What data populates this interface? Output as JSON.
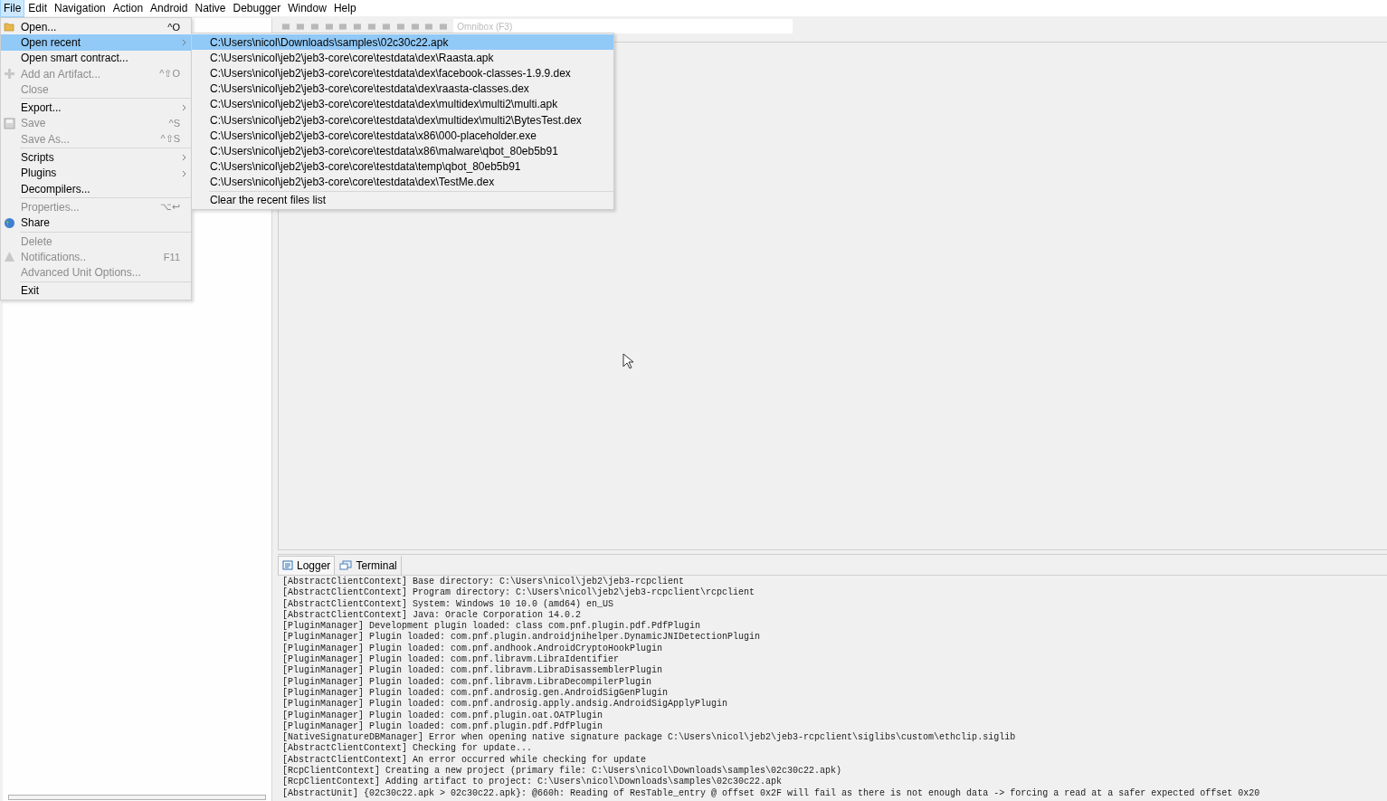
{
  "menubar": [
    {
      "label": "File",
      "selected": true
    },
    {
      "label": "Edit",
      "selected": false
    },
    {
      "label": "Navigation",
      "selected": false
    },
    {
      "label": "Action",
      "selected": false
    },
    {
      "label": "Android",
      "selected": false
    },
    {
      "label": "Native",
      "selected": false
    },
    {
      "label": "Debugger",
      "selected": false
    },
    {
      "label": "Window",
      "selected": false
    },
    {
      "label": "Help",
      "selected": false
    }
  ],
  "omnibox": {
    "placeholder": "Omnibox (F3)"
  },
  "file_menu": [
    {
      "kind": "folder",
      "label": "Open...",
      "shortcut": "^O",
      "disabled": false,
      "submenu": false,
      "selected": false
    },
    {
      "kind": "plain",
      "label": "Open recent",
      "disabled": false,
      "submenu": true,
      "selected": true
    },
    {
      "kind": "plain",
      "label": "Open smart contract...",
      "disabled": false,
      "submenu": false,
      "selected": false
    },
    {
      "kind": "plus",
      "label": "Add an Artifact...",
      "shortcut": "^⇧O",
      "disabled": true,
      "submenu": false,
      "selected": false
    },
    {
      "kind": "plain",
      "label": "Close",
      "disabled": true,
      "submenu": false,
      "selected": false
    },
    {
      "kind": "separator"
    },
    {
      "kind": "plain",
      "label": "Export...",
      "disabled": false,
      "submenu": true,
      "selected": false
    },
    {
      "kind": "disk",
      "label": "Save",
      "shortcut": "^S",
      "disabled": true,
      "submenu": false,
      "selected": false
    },
    {
      "kind": "plain",
      "label": "Save As...",
      "shortcut": "^⇧S",
      "disabled": true,
      "submenu": false,
      "selected": false
    },
    {
      "kind": "separator"
    },
    {
      "kind": "plain",
      "label": "Scripts",
      "disabled": false,
      "submenu": true,
      "selected": false
    },
    {
      "kind": "plain",
      "label": "Plugins",
      "disabled": false,
      "submenu": true,
      "selected": false
    },
    {
      "kind": "plain",
      "label": "Decompilers...",
      "disabled": false,
      "submenu": false,
      "selected": false
    },
    {
      "kind": "separator"
    },
    {
      "kind": "plain",
      "label": "Properties...",
      "shortcut": "⌥↩",
      "disabled": true,
      "submenu": false,
      "selected": false
    },
    {
      "kind": "globe",
      "label": "Share",
      "disabled": false,
      "submenu": false,
      "selected": false
    },
    {
      "kind": "separator"
    },
    {
      "kind": "plain",
      "label": "Delete",
      "disabled": true,
      "submenu": false,
      "selected": false
    },
    {
      "kind": "warning",
      "label": "Notifications..",
      "shortcut": "F11",
      "disabled": true,
      "submenu": false,
      "selected": false
    },
    {
      "kind": "plain",
      "label": "Advanced Unit Options...",
      "disabled": true,
      "submenu": false,
      "selected": false
    },
    {
      "kind": "separator"
    },
    {
      "kind": "plain",
      "label": "Exit",
      "disabled": false,
      "submenu": false,
      "selected": false
    }
  ],
  "recent_menu": [
    {
      "kind": "item",
      "label": "C:\\Users\\nicol\\Downloads\\samples\\02c30c22.apk",
      "selected": true
    },
    {
      "kind": "item",
      "label": "C:\\Users\\nicol\\jeb2\\jeb3-core\\core\\testdata\\dex\\Raasta.apk",
      "selected": false
    },
    {
      "kind": "item",
      "label": "C:\\Users\\nicol\\jeb2\\jeb3-core\\core\\testdata\\dex\\facebook-classes-1.9.9.dex",
      "selected": false
    },
    {
      "kind": "item",
      "label": "C:\\Users\\nicol\\jeb2\\jeb3-core\\core\\testdata\\dex\\raasta-classes.dex",
      "selected": false
    },
    {
      "kind": "item",
      "label": "C:\\Users\\nicol\\jeb2\\jeb3-core\\core\\testdata\\dex\\multidex\\multi2\\multi.apk",
      "selected": false
    },
    {
      "kind": "item",
      "label": "C:\\Users\\nicol\\jeb2\\jeb3-core\\core\\testdata\\dex\\multidex\\multi2\\BytesTest.dex",
      "selected": false
    },
    {
      "kind": "item",
      "label": "C:\\Users\\nicol\\jeb2\\jeb3-core\\core\\testdata\\x86\\000-placeholder.exe",
      "selected": false
    },
    {
      "kind": "item",
      "label": "C:\\Users\\nicol\\jeb2\\jeb3-core\\core\\testdata\\x86\\malware\\qbot_80eb5b91",
      "selected": false
    },
    {
      "kind": "item",
      "label": "C:\\Users\\nicol\\jeb2\\jeb3-core\\core\\testdata\\temp\\qbot_80eb5b91",
      "selected": false
    },
    {
      "kind": "item",
      "label": "C:\\Users\\nicol\\jeb2\\jeb3-core\\core\\testdata\\dex\\TestMe.dex",
      "selected": false
    },
    {
      "kind": "separator"
    },
    {
      "kind": "item",
      "label": "Clear the recent files list",
      "selected": false
    }
  ],
  "console_tabs": [
    {
      "label": "Logger",
      "selected": true
    },
    {
      "label": "Terminal",
      "selected": false
    }
  ],
  "log_lines": [
    "[AbstractClientContext] Base directory: C:\\Users\\nicol\\jeb2\\jeb3-rcpclient",
    "[AbstractClientContext] Program directory: C:\\Users\\nicol\\jeb2\\jeb3-rcpclient\\rcpclient",
    "[AbstractClientContext] System: Windows 10 10.0 (amd64) en_US",
    "[AbstractClientContext] Java: Oracle Corporation 14.0.2",
    "[PluginManager] Development plugin loaded: class com.pnf.plugin.pdf.PdfPlugin",
    "[PluginManager] Plugin loaded: com.pnf.plugin.androidjnihelper.DynamicJNIDetectionPlugin",
    "[PluginManager] Plugin loaded: com.pnf.andhook.AndroidCryptoHookPlugin",
    "[PluginManager] Plugin loaded: com.pnf.libravm.LibraIdentifier",
    "[PluginManager] Plugin loaded: com.pnf.libravm.LibraDisassemblerPlugin",
    "[PluginManager] Plugin loaded: com.pnf.libravm.LibraDecompilerPlugin",
    "[PluginManager] Plugin loaded: com.pnf.androsig.gen.AndroidSigGenPlugin",
    "[PluginManager] Plugin loaded: com.pnf.androsig.apply.andsig.AndroidSigApplyPlugin",
    "[PluginManager] Plugin loaded: com.pnf.plugin.oat.OATPlugin",
    "[PluginManager] Plugin loaded: com.pnf.plugin.pdf.PdfPlugin",
    "[NativeSignatureDBManager] Error when opening native signature package C:\\Users\\nicol\\jeb2\\jeb3-rcpclient\\siglibs\\custom\\ethclip.siglib",
    "[AbstractClientContext] Checking for update...",
    "[AbstractClientContext] An error occurred while checking for update",
    "[RcpClientContext] Creating a new project (primary file: C:\\Users\\nicol\\Downloads\\samples\\02c30c22.apk)",
    "[RcpClientContext] Adding artifact to project: C:\\Users\\nicol\\Downloads\\samples\\02c30c22.apk",
    "[AbstractUnit] {02c30c22.apk > 02c30c22.apk}: @660h: Reading of ResTable_entry @ offset 0x2F will fail as there is not enough data -> forcing a read at a safer expected offset 0x20"
  ]
}
